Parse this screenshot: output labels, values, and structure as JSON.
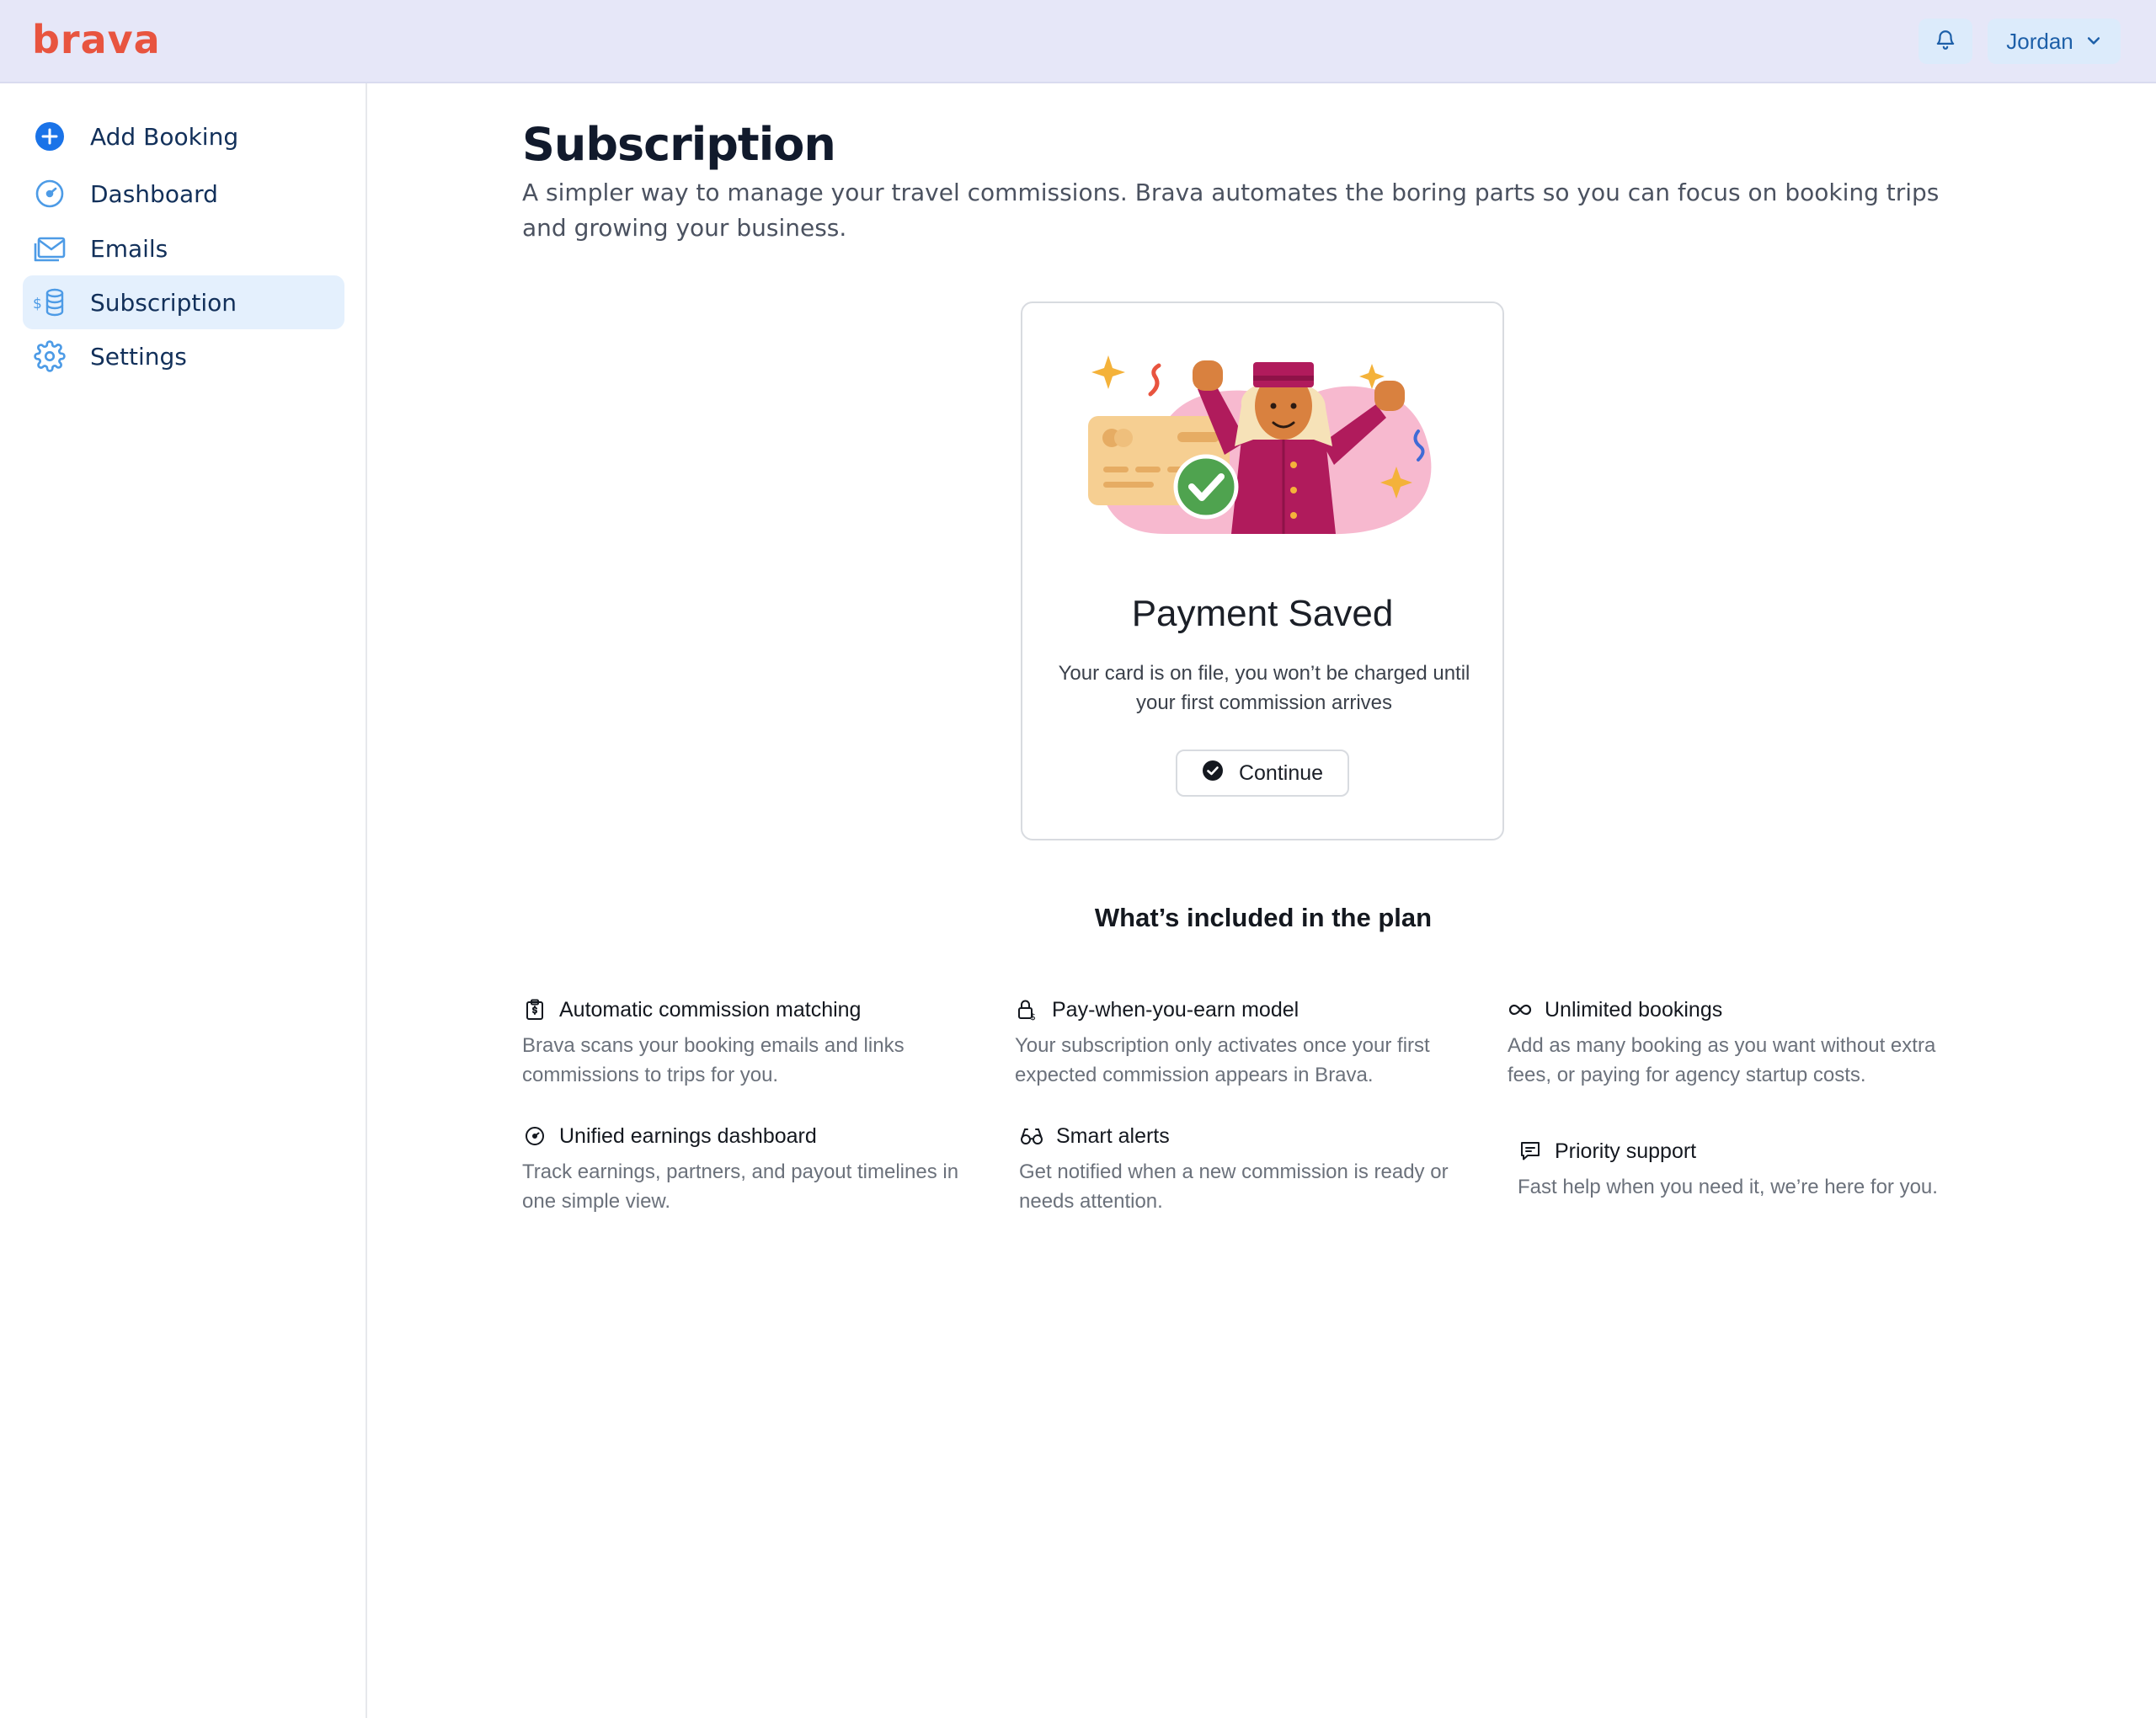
{
  "brand": {
    "logo_text": "brava",
    "logo_color": "#e8543f"
  },
  "header": {
    "notifications_icon": "bell-icon",
    "user_name": "Jordan",
    "user_menu_icon": "chevron-down-icon"
  },
  "sidebar": {
    "items": [
      {
        "label": "Add Booking",
        "icon": "plus-circle-icon",
        "active": false
      },
      {
        "label": "Dashboard",
        "icon": "gauge-icon",
        "active": false
      },
      {
        "label": "Emails",
        "icon": "mail-icon",
        "active": false
      },
      {
        "label": "Subscription",
        "icon": "coins-icon",
        "active": true
      },
      {
        "label": "Settings",
        "icon": "gear-icon",
        "active": false
      }
    ]
  },
  "main": {
    "title": "Subscription",
    "subtitle": "A simpler way to manage your travel commissions. Brava automates the boring parts so you can focus on booking trips and growing your business."
  },
  "card": {
    "illustration": "bellhop-celebrating-with-credit-card-illustration",
    "title": "Payment Saved",
    "text": "Your card is on file, you won’t be charged until your first commission arrives",
    "button_label": "Continue",
    "button_icon": "check-circle-icon"
  },
  "plan": {
    "title": "What’s included in the plan",
    "features": [
      {
        "icon": "clipboard-dollar-icon",
        "title": "Automatic commission matching",
        "description": "Brava scans your booking emails and links commissions to trips for you."
      },
      {
        "icon": "lock-dollar-icon",
        "title": "Pay-when-you-earn model",
        "description": "Your subscription only activates once your first expected commission appears in Brava."
      },
      {
        "icon": "infinity-icon",
        "title": "Unlimited bookings",
        "description": "Add as many booking as you want without extra fees, or paying for agency startup costs."
      },
      {
        "icon": "gauge-icon",
        "title": "Unified earnings dashboard",
        "description": "Track earnings, partners, and payout timelines in one simple view."
      },
      {
        "icon": "glasses-icon",
        "title": "Smart alerts",
        "description": "Get notified when a new commission is ready or needs attention."
      },
      {
        "icon": "chat-icon",
        "title": "Priority support",
        "description": "Fast help when you need it, we’re here for you."
      }
    ]
  },
  "colors": {
    "accent": "#1a73e8",
    "nav_text": "#12305a",
    "active_bg": "#e4f0fd",
    "topbar_bg": "#e6e7f8"
  }
}
